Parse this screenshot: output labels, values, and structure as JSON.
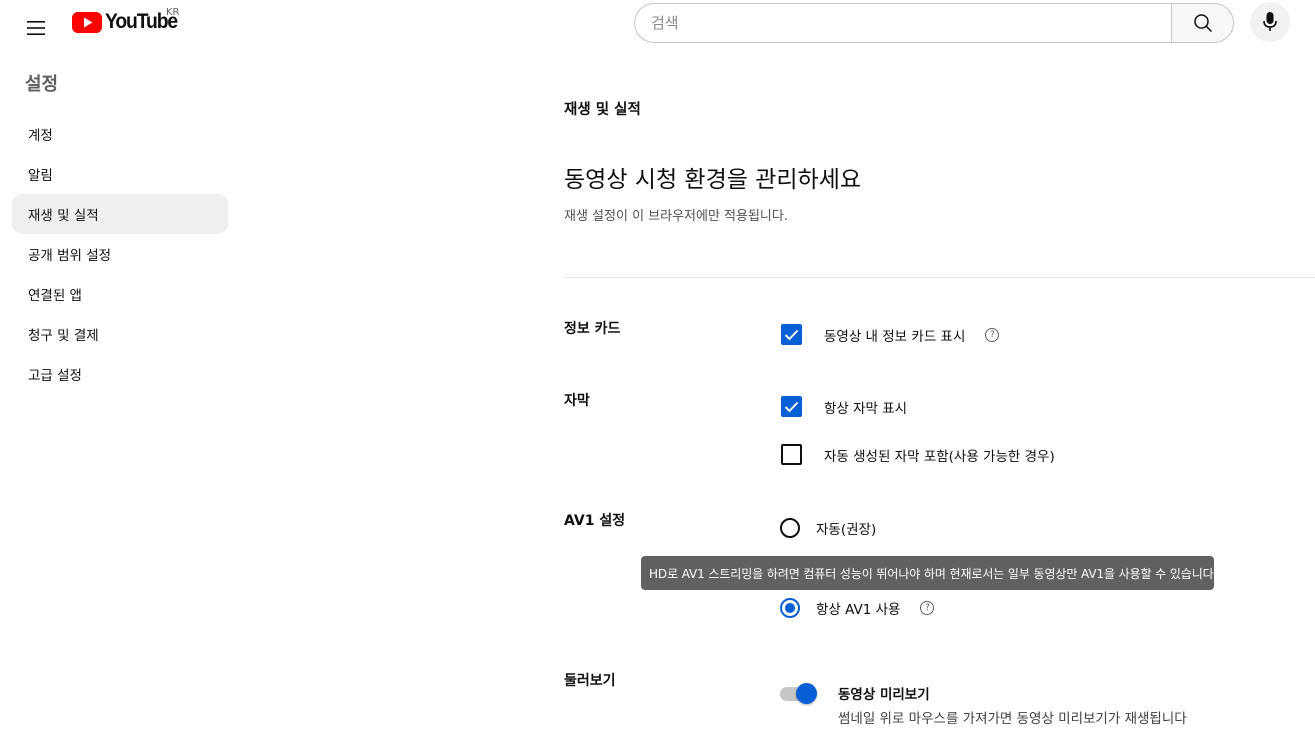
{
  "header": {
    "logo_text": "YouTube",
    "logo_region": "KR",
    "search_placeholder": "검색",
    "brand_color": "#ff0000"
  },
  "sidebar": {
    "title": "설정",
    "items": [
      {
        "label": "계정",
        "active": false
      },
      {
        "label": "알림",
        "active": false
      },
      {
        "label": "재생 및 실적",
        "active": true
      },
      {
        "label": "공개 범위 설정",
        "active": false
      },
      {
        "label": "연결된 앱",
        "active": false
      },
      {
        "label": "청구 및 결제",
        "active": false
      },
      {
        "label": "고급 설정",
        "active": false
      }
    ]
  },
  "main": {
    "section": "재생 및 실적",
    "heading": "동영상 시청 환경을 관리하세요",
    "description": "재생 설정이 이 브라우저에만 적용됩니다.",
    "info_cards": {
      "label": "정보 카드",
      "option": {
        "label": "동영상 내 정보 카드 표시",
        "checked": true
      }
    },
    "captions": {
      "label": "자막",
      "options": [
        {
          "label": "항상 자막 표시",
          "checked": true
        },
        {
          "label": "자동 생성된 자막 포함(사용 가능한 경우)",
          "checked": false
        }
      ]
    },
    "av1": {
      "label": "AV1 설정",
      "options": [
        {
          "label": "자동(권장)",
          "selected": false
        },
        {
          "label": "항상 AV1 사용",
          "selected": true
        }
      ],
      "tooltip": "HD로 AV1 스트리밍을 하려면 컴퓨터 성능이 뛰어나야 하며 현재로서는 일부 동영상만 AV1을 사용할 수 있습니다."
    },
    "browse": {
      "label": "둘러보기",
      "toggle_title": "동영상 미리보기",
      "toggle_desc": "썸네일 위로 마우스를 가져가면 동영상 미리보기가 재생됩니다",
      "toggle_on": true
    },
    "accent_color": "#065fd4"
  }
}
